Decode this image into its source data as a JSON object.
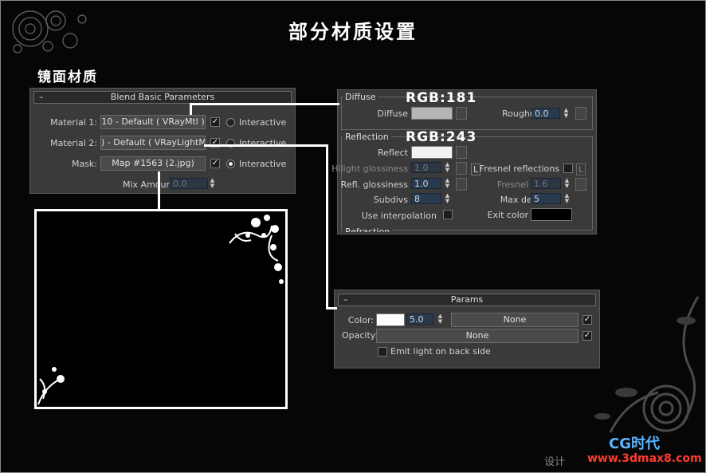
{
  "page": {
    "title": "部分材质设置",
    "subtitle": "镜面材质"
  },
  "blend": {
    "header": "Blend Basic Parameters",
    "collapse": "–",
    "rows": [
      {
        "label": "Material 1:",
        "value": "10 - Default  ( VRayMtl )",
        "checked": true,
        "radio": false,
        "interactive": "Interactive"
      },
      {
        "label": "Material 2:",
        "value": ") - Default  ( VRayLightMtl )",
        "checked": true,
        "radio": false,
        "interactive": "Interactive"
      },
      {
        "label": "Mask:",
        "value": "Map #1563 (2.jpg)",
        "checked": true,
        "radio": true,
        "interactive": "Interactive"
      }
    ],
    "mix_label": "Mix Amount:",
    "mix_value": "0.0"
  },
  "vray": {
    "diffuse_group": "Diffuse",
    "diffuse_label": "Diffuse",
    "diffuse_color": "#b5b5b5",
    "roughness_label": "Roughness",
    "roughness_value": "0.0",
    "reflection_group": "Reflection",
    "reflect_label": "Reflect",
    "reflect_color": "#f3f3f3",
    "hilight_label": "Hilight glossiness",
    "hilight_value": "1.0",
    "hilight_lock": "L",
    "fresnel_label": "Fresnel reflections",
    "fresnel_lock": "L",
    "refl_gloss_label": "Refl. glossiness",
    "refl_gloss_value": "1.0",
    "fresnel_ior_label": "Fresnel IOR",
    "fresnel_ior_value": "1.6",
    "subdivs_label": "Subdivs",
    "subdivs_value": "8",
    "max_depth_label": "Max depth",
    "max_depth_value": "5",
    "use_interp_label": "Use interpolation",
    "exit_color_label": "Exit color",
    "exit_color": "#000000",
    "refraction_group": "Refraction"
  },
  "annotations": {
    "rgb1": "RGB:181",
    "rgb2": "RGB:243"
  },
  "params": {
    "header": "Params",
    "collapse": "–",
    "color_label": "Color:",
    "color": "#ffffff",
    "multiplier": "5.0",
    "color_map": "None",
    "opacity_label": "Opacity:",
    "opacity_map": "None",
    "emit_label": "Emit light on back side"
  },
  "watermark": {
    "brand": "CG时代",
    "url": "www.3dmax8.com",
    "design_text": "设计"
  }
}
